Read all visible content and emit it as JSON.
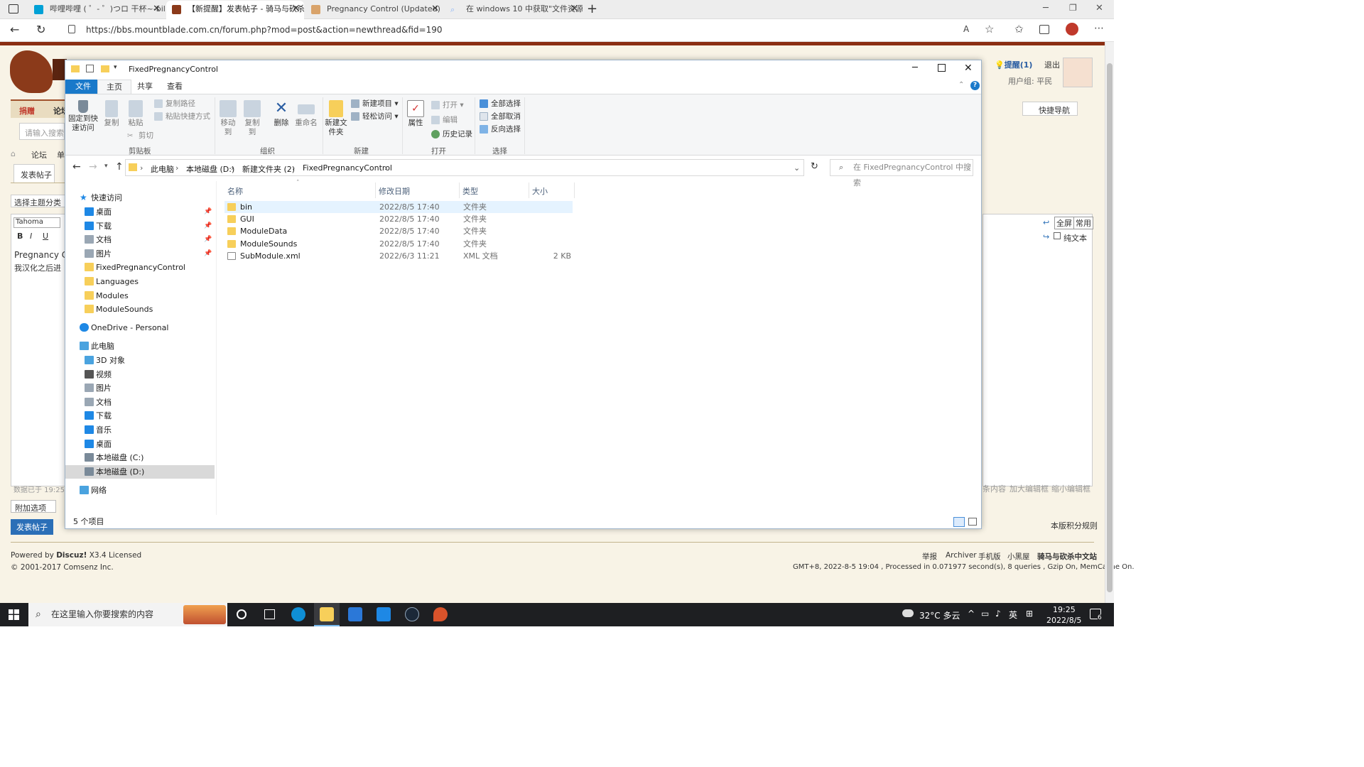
{
  "browser": {
    "tabs": [
      {
        "title": "哔哩哔哩 ( ゜- ゜)つロ 干杯~-bili",
        "icon_color": "#00a1d6"
      },
      {
        "title": "【新提醒】发表帖子 - 骑马与砍杀",
        "icon_color": "#8b3a1a"
      },
      {
        "title": "Pregnancy Control (Updated) at",
        "icon_color": "#d9a36a"
      },
      {
        "title": "在 windows 10 中获取\"文件资源",
        "icon_color": "#8ab4f8"
      }
    ],
    "url": "https://bbs.mountblade.com.cn/forum.php?mod=post&action=newthread&fid=190"
  },
  "forum": {
    "donate": "捐赠",
    "forum_label": "论坛",
    "search_placeholder": "请输入搜索内",
    "breadcrumb_forum": "论坛",
    "breadcrumb_next": "单",
    "post_tab": "发表帖子",
    "topic_select": "选择主题分类",
    "font_name": "Tahoma",
    "editor_line1": "Pregnancy Cor",
    "editor_line2": "我汉化之后进",
    "saved_data": "数据已于 19:25",
    "attach_options": "附加选项",
    "submit_post": "发表帖子",
    "remind": "提醒(1)",
    "logout": "退出",
    "usergroup": "用户组: 平民",
    "quick_nav": "快捷导航",
    "fullscreen": "全屏",
    "common": "常用",
    "plain_text": "纯文本",
    "shrink_content": "条内容",
    "enlarge_editor": "加大编辑框",
    "shrink_editor": "缩小编辑框",
    "points_rule": "本版积分规则",
    "powered": "Powered by",
    "discuz": "Discuz!",
    "version": "X3.4 Licensed",
    "copyright": "© 2001-2017 Comsenz Inc.",
    "footer_links": [
      "举报",
      "Archiver",
      "手机版",
      "小黑屋"
    ],
    "site_name": "骑马与砍杀中文站",
    "gmt": "GMT+8, 2022-8-5 19:04 , Processed in 0.071977 second(s), 8 queries , Gzip On, MemCache On."
  },
  "explorer": {
    "title": "FixedPregnancyControl",
    "ribbon_tabs": [
      "文件",
      "主页",
      "共享",
      "查看"
    ],
    "clipboard": {
      "pin": "固定到快速访问",
      "copy": "复制",
      "paste": "粘贴",
      "copy_path": "复制路径",
      "paste_shortcut": "粘贴快捷方式",
      "cut": "剪切",
      "group": "剪贴板"
    },
    "organize": {
      "move_to": "移动到",
      "copy_to": "复制到",
      "delete": "删除",
      "rename": "重命名",
      "group": "组织"
    },
    "new": {
      "new_item": "新建项目",
      "easy_access": "轻松访问",
      "new_folder": "新建文件夹",
      "group": "新建"
    },
    "open": {
      "properties": "属性",
      "open": "打开",
      "edit": "编辑",
      "history": "历史记录",
      "group": "打开"
    },
    "select": {
      "select_all": "全部选择",
      "select_none": "全部取消",
      "invert": "反向选择",
      "group": "选择"
    },
    "path": [
      "此电脑",
      "本地磁盘 (D:)",
      "新建文件夹 (2)",
      "FixedPregnancyControl"
    ],
    "search_placeholder": "在 FixedPregnancyControl 中搜索",
    "sidebar": {
      "quick_access": "快速访问",
      "quick_items": [
        {
          "label": "桌面",
          "pinned": true,
          "color": "#1e88e5"
        },
        {
          "label": "下载",
          "pinned": true,
          "color": "#1e88e5"
        },
        {
          "label": "文档",
          "pinned": true,
          "color": "#9aa7b4"
        },
        {
          "label": "图片",
          "pinned": true,
          "color": "#9aa7b4"
        },
        {
          "label": "FixedPregnancyControl",
          "pinned": false,
          "color": "#f7cf5a"
        },
        {
          "label": "Languages",
          "pinned": false,
          "color": "#f7cf5a"
        },
        {
          "label": "Modules",
          "pinned": false,
          "color": "#f7cf5a"
        },
        {
          "label": "ModuleSounds",
          "pinned": false,
          "color": "#f7cf5a"
        }
      ],
      "onedrive": "OneDrive - Personal",
      "this_pc": "此电脑",
      "pc_items": [
        {
          "label": "3D 对象",
          "color": "#4aa3df"
        },
        {
          "label": "视频",
          "color": "#555"
        },
        {
          "label": "图片",
          "color": "#9aa7b4"
        },
        {
          "label": "文档",
          "color": "#9aa7b4"
        },
        {
          "label": "下载",
          "color": "#1e88e5"
        },
        {
          "label": "音乐",
          "color": "#1e88e5"
        },
        {
          "label": "桌面",
          "color": "#1e88e5"
        },
        {
          "label": "本地磁盘 (C:)",
          "color": "#7a8a99"
        },
        {
          "label": "本地磁盘 (D:)",
          "color": "#7a8a99"
        }
      ],
      "network": "网络"
    },
    "columns": {
      "name": "名称",
      "modified": "修改日期",
      "type": "类型",
      "size": "大小"
    },
    "files": [
      {
        "name": "bin",
        "modified": "2022/8/5 17:40",
        "type": "文件夹",
        "size": ""
      },
      {
        "name": "GUI",
        "modified": "2022/8/5 17:40",
        "type": "文件夹",
        "size": ""
      },
      {
        "name": "ModuleData",
        "modified": "2022/8/5 17:40",
        "type": "文件夹",
        "size": ""
      },
      {
        "name": "ModuleSounds",
        "modified": "2022/8/5 17:40",
        "type": "文件夹",
        "size": ""
      },
      {
        "name": "SubModule.xml",
        "modified": "2022/6/3 11:21",
        "type": "XML 文档",
        "size": "2 KB"
      }
    ],
    "status": "5 个项目"
  },
  "taskbar": {
    "search_placeholder": "在这里输入你要搜索的内容",
    "weather": "32°C 多云",
    "ime": "英",
    "time": "19:25",
    "date": "2022/8/5",
    "notifications": "6"
  },
  "colors": {
    "accent": "#1979ca",
    "forum_bg": "#f8f3e6",
    "folder": "#f7cf5a"
  }
}
